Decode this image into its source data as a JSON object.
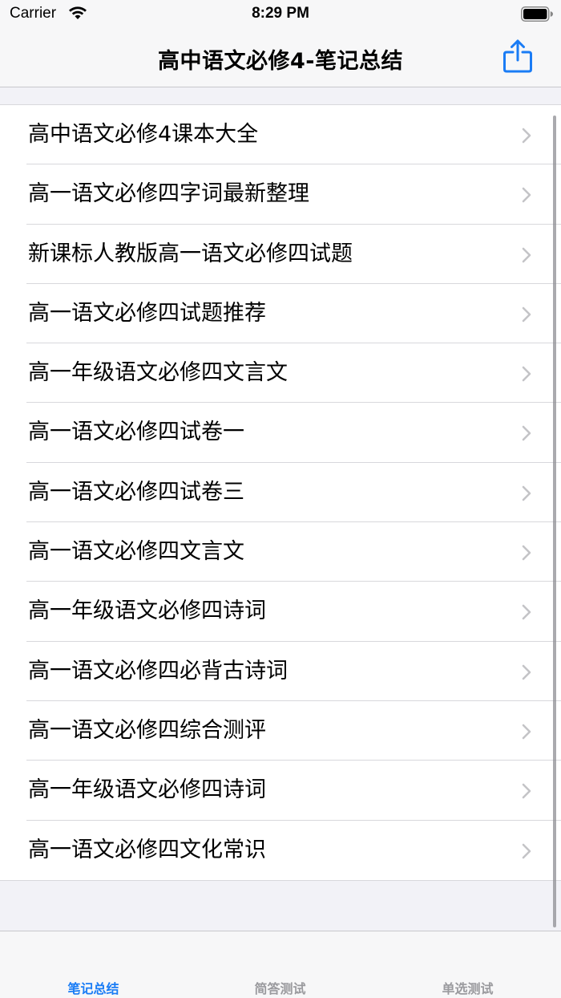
{
  "status_bar": {
    "carrier": "Carrier",
    "time": "8:29 PM"
  },
  "nav": {
    "title": "高中语文必修4-笔记总结",
    "share_icon": "share-icon"
  },
  "list": {
    "items": [
      {
        "label": "高中语文必修4课本大全"
      },
      {
        "label": "高一语文必修四字词最新整理"
      },
      {
        "label": "新课标人教版高一语文必修四试题"
      },
      {
        "label": "高一语文必修四试题推荐"
      },
      {
        "label": "高一年级语文必修四文言文"
      },
      {
        "label": "高一语文必修四试卷一"
      },
      {
        "label": "高一语文必修四试卷三"
      },
      {
        "label": "高一语文必修四文言文"
      },
      {
        "label": "高一年级语文必修四诗词"
      },
      {
        "label": "高一语文必修四必背古诗词"
      },
      {
        "label": "高一语文必修四综合测评"
      },
      {
        "label": "高一年级语文必修四诗词"
      },
      {
        "label": "高一语文必修四文化常识"
      }
    ]
  },
  "tabs": [
    {
      "label": "笔记总结",
      "active": true
    },
    {
      "label": "简答测试",
      "active": false
    },
    {
      "label": "单选测试",
      "active": false
    }
  ],
  "colors": {
    "accent": "#1a7cf5",
    "inactive_tab": "#9a9a9e",
    "chevron": "#c4c4c7"
  }
}
